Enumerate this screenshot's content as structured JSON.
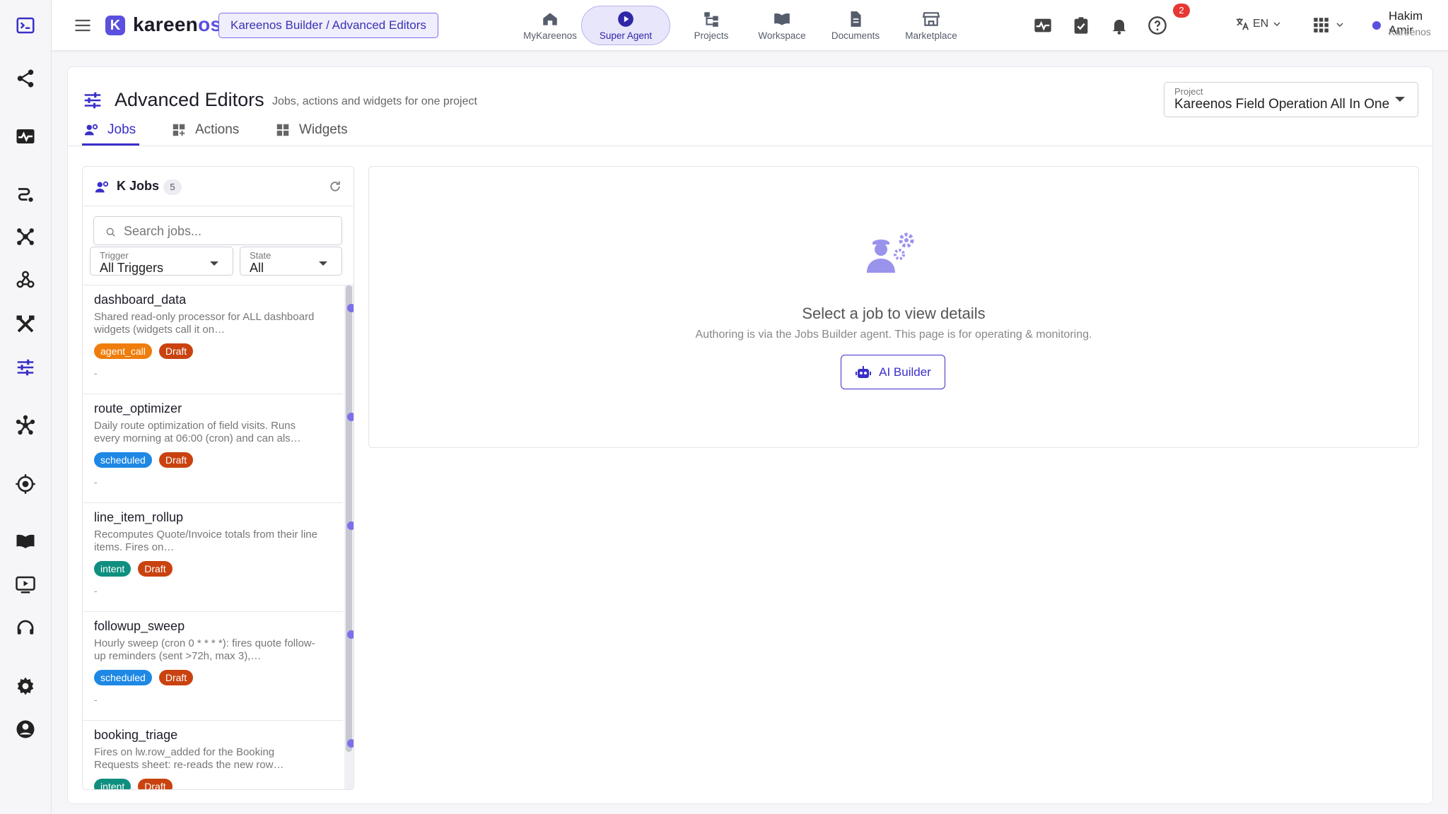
{
  "header": {
    "brand_a": "kareen",
    "brand_b": "os",
    "logo_letter": "K",
    "breadcrumb": "Kareenos Builder / Advanced Editors",
    "nav": [
      {
        "label": "MyKareenos",
        "icon": "home-icon"
      },
      {
        "label": "Super Agent",
        "icon": "play-circle-icon",
        "active": true
      },
      {
        "label": "Projects",
        "icon": "hierarchy-icon"
      },
      {
        "label": "Workspace",
        "icon": "book-icon"
      },
      {
        "label": "Documents",
        "icon": "document-icon"
      },
      {
        "label": "Marketplace",
        "icon": "store-icon"
      }
    ],
    "notification_count": "2",
    "language": "EN",
    "user_name": "Hakim Amir",
    "user_org": "Kareenos"
  },
  "page": {
    "title": "Advanced Editors",
    "subtitle": "Jobs, actions and widgets for one project",
    "project_label": "Project",
    "project_value": "Kareenos Field Operation All In One",
    "tabs": [
      {
        "label": "Jobs",
        "active": true
      },
      {
        "label": "Actions"
      },
      {
        "label": "Widgets"
      }
    ]
  },
  "jobs_panel": {
    "title": "K Jobs",
    "count": "5",
    "search_placeholder": "Search jobs...",
    "trigger_label": "Trigger",
    "trigger_value": "All Triggers",
    "state_label": "State",
    "state_value": "All",
    "jobs": [
      {
        "name": "dashboard_data",
        "desc": "Shared read-only processor for ALL dashboard widgets (widgets call it on…",
        "tag": "agent_call",
        "status": "Draft",
        "meta": "-"
      },
      {
        "name": "route_optimizer",
        "desc": "Daily route optimization of field visits. Runs every morning at 06:00 (cron) and can als…",
        "tag": "scheduled",
        "status": "Draft",
        "meta": "-"
      },
      {
        "name": "line_item_rollup",
        "desc": "Recomputes Quote/Invoice totals from their line items. Fires on…",
        "tag": "intent",
        "status": "Draft",
        "meta": "-"
      },
      {
        "name": "followup_sweep",
        "desc": "Hourly sweep (cron 0 * * * *): fires quote follow-up reminders (sent >72h, max 3),…",
        "tag": "scheduled",
        "status": "Draft",
        "meta": "-"
      },
      {
        "name": "booking_triage",
        "desc": "Fires on lw.row_added for the Booking Requests sheet: re-reads the new row…",
        "tag": "intent",
        "status": "Draft",
        "meta": "-"
      }
    ]
  },
  "detail": {
    "empty_title": "Select a job to view details",
    "empty_sub": "Authoring is via the Jobs Builder agent. This page is for operating & monitoring.",
    "ai_builder": "AI Builder"
  },
  "colors": {
    "accent": "#3a2fc8",
    "brand": "#5b4fe0",
    "draft": "#c9420f",
    "agent_call": "#ef7d0b",
    "scheduled": "#1e88e5",
    "intent": "#0f8f7f"
  }
}
